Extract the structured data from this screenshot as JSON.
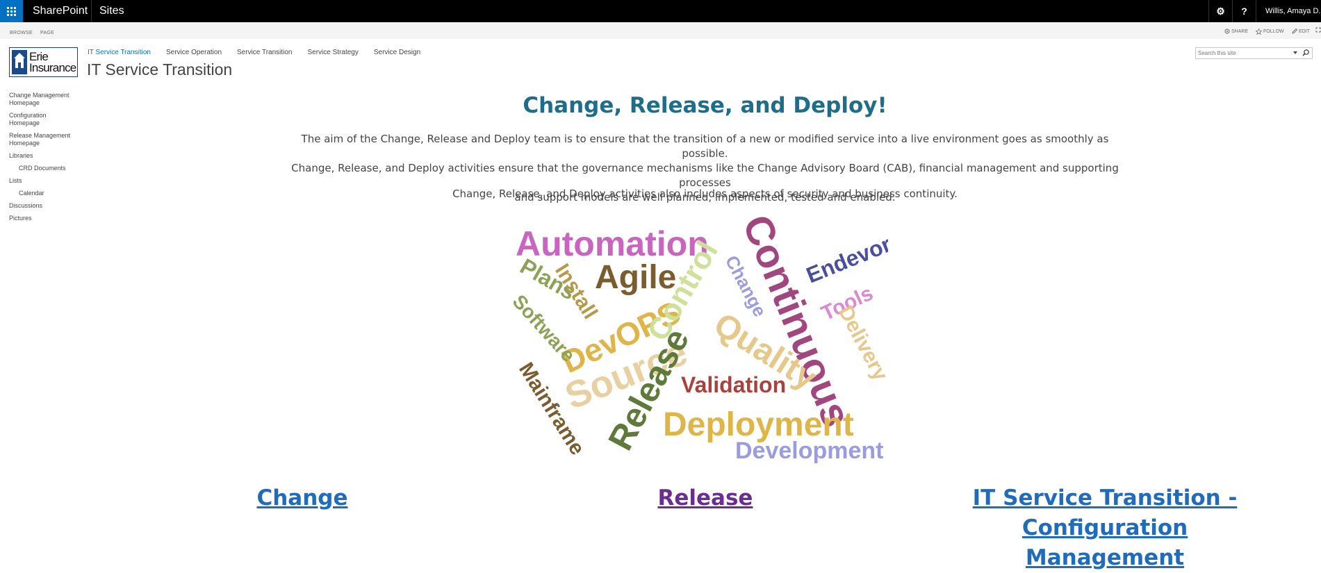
{
  "suitebar": {
    "brand": "SharePoint",
    "sites_link": "Sites",
    "gear_glyph": "⚙",
    "help_glyph": "?",
    "user_name": "Willis, Amaya D."
  },
  "ribbon": {
    "browse": "BROWSE",
    "page": "PAGE",
    "share": "SHARE",
    "follow": "FOLLOW",
    "edit": "EDIT"
  },
  "header": {
    "logo_text_line1": "Erie",
    "logo_text_line2": "Insurance",
    "site_title": "IT Service Transition",
    "top_nav": [
      {
        "label": "IT Service Transition",
        "selected": true
      },
      {
        "label": "Service Operation"
      },
      {
        "label": "Service Transition"
      },
      {
        "label": "Service Strategy"
      },
      {
        "label": "Service Design"
      }
    ],
    "search_placeholder": "Search this site"
  },
  "quicklaunch": [
    {
      "label": "Change Management Homepage"
    },
    {
      "label": "Configuration Homepage"
    },
    {
      "label": "Release Management Homepage"
    },
    {
      "label": "Libraries"
    },
    {
      "label": "CRD Documents"
    },
    {
      "label": "Lists"
    },
    {
      "label": "Calendar"
    },
    {
      "label": "Discussions"
    },
    {
      "label": "Pictures"
    }
  ],
  "main": {
    "heading": "Change, Release, and Deploy!",
    "intro_line1": "The aim of the Change, Release and Deploy team is to ensure that the transition of a new or modified service into a live environment goes as smoothly as possible.",
    "intro_line2": "Change, Release, and Deploy activities ensure that the governance mechanisms like the Change Advisory Board (CAB), financial management and supporting processes",
    "intro_line3": "and support models are well planned, implemented, tested and enabled.",
    "intro2": "Change, Release, and Deploy activities also includes aspects of security and business continuity."
  },
  "wordcloud": {
    "words": [
      {
        "text": "Automation",
        "color": "#c964c0"
      },
      {
        "text": "Agile",
        "color": "#7a5c2e"
      },
      {
        "text": "Continuous",
        "color": "#a2467f"
      },
      {
        "text": "Endevor",
        "color": "#4a4e9e"
      },
      {
        "text": "Change",
        "color": "#9b9be0"
      },
      {
        "text": "Tools",
        "color": "#d88ad2"
      },
      {
        "text": "Delivery",
        "color": "#e6c98a"
      },
      {
        "text": "Plans",
        "color": "#8da256"
      },
      {
        "text": "Install",
        "color": "#b59a4a"
      },
      {
        "text": "DevOPS",
        "color": "#e0b548"
      },
      {
        "text": "Control",
        "color": "#cfe09a"
      },
      {
        "text": "Software",
        "color": "#8da256"
      },
      {
        "text": "Quality",
        "color": "#e6c98a"
      },
      {
        "text": "Source",
        "color": "#e8d0a0"
      },
      {
        "text": "Release",
        "color": "#5e7a3a"
      },
      {
        "text": "Validation",
        "color": "#a8423e"
      },
      {
        "text": "Mainframe",
        "color": "#7a5c2e"
      },
      {
        "text": "Deployment",
        "color": "#e0b548"
      },
      {
        "text": "Development",
        "color": "#9b9be0"
      }
    ]
  },
  "links": {
    "change": "Change",
    "release": "Release",
    "config_line1": "IT Service Transition - Configuration",
    "config_line2": "Management"
  }
}
